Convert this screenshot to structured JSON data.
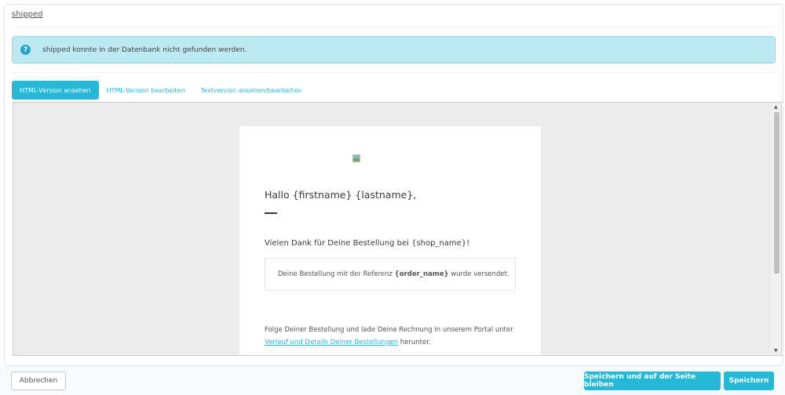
{
  "header": {
    "title": "shipped"
  },
  "alert": {
    "icon": "question-circle-icon",
    "text": "shipped konnte in der Datenbank nicht gefunden werden."
  },
  "tabs": [
    {
      "label": "HTML-Version ansehen",
      "active": true
    },
    {
      "label": "HTML-Version bearbeiten"
    },
    {
      "label": "Textversion ansehen/bearbeiten"
    }
  ],
  "email": {
    "greeting": "Hallo {firstname} {lastname},",
    "thanks": "Vielen Dank für Deine Bestellung bei {shop_name}!",
    "box_pre": "Deine Bestellung mit der Referenz ",
    "box_bold": "{order_name}",
    "box_post": " wurde versendet.",
    "follow_text": "Folge Deiner Bestellung und lade Deine Rechnung in unserem Portal unter",
    "follow_link": "Verlauf und Details Deiner Bestellungen",
    "follow_post": " herunter."
  },
  "footer": {
    "cancel": "Abbrechen",
    "save_stay": "Speichern und auf der Seite bleiben",
    "save": "Speichern"
  },
  "colors": {
    "accent": "#25b9d7",
    "alert_bg": "#bde9f2"
  }
}
